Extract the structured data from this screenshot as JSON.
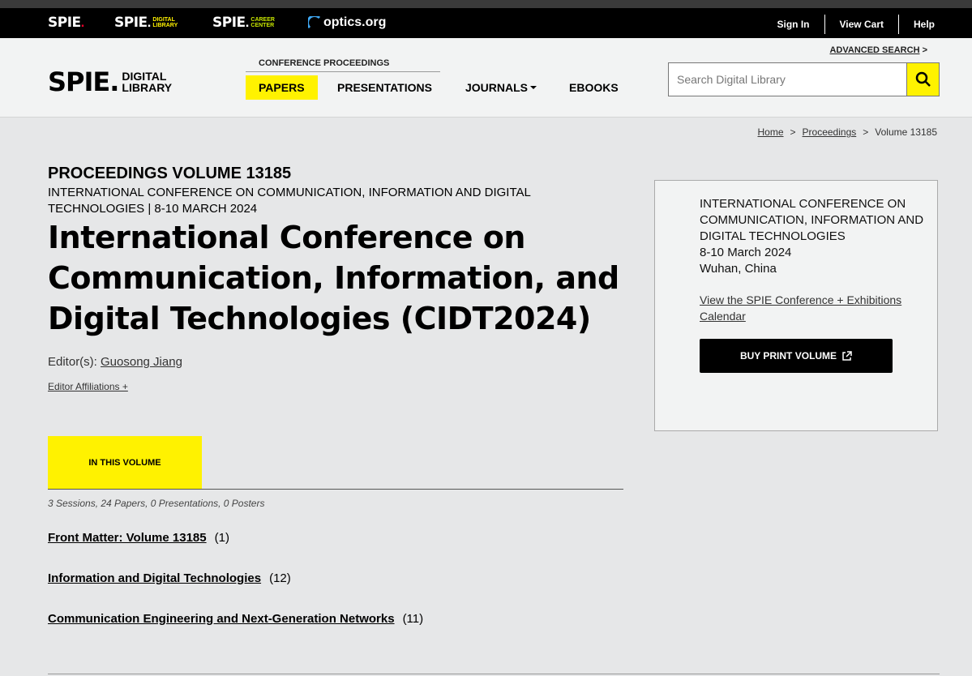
{
  "topbar": {
    "brands": [
      {
        "name": "SPIE",
        "sub": ""
      },
      {
        "name": "SPIE",
        "sub_line1": "DIGITAL",
        "sub_line2": "LIBRARY"
      },
      {
        "name": "SPIE",
        "sub_line1": "CAREER",
        "sub_line2": "CENTER"
      }
    ],
    "optics_label": "optics.org",
    "links": [
      "Sign In",
      "View Cart",
      "Help"
    ]
  },
  "header": {
    "logo_main": "SPIE.",
    "logo_sub1": "DIGITAL",
    "logo_sub2": "LIBRARY",
    "conference_label": "CONFERENCE PROCEEDINGS",
    "nav": [
      "PAPERS",
      "PRESENTATIONS",
      "JOURNALS",
      "EBOOKS"
    ],
    "advanced_search": "ADVANCED SEARCH",
    "search_placeholder": "Search Digital Library"
  },
  "breadcrumb": [
    "Home",
    "Proceedings",
    "Volume 13185"
  ],
  "main": {
    "volume_heading": "PROCEEDINGS VOLUME 13185",
    "volume_subheading": "INTERNATIONAL CONFERENCE ON COMMUNICATION, INFORMATION AND DIGITAL TECHNOLOGIES | 8-10 MARCH 2024",
    "title": "International Conference on Communication, Information, and Digital Technologies (CIDT2024)",
    "editors_label": "Editor(s):",
    "editor_name": "Guosong Jiang",
    "editor_affiliations": "Editor Affiliations +",
    "tab_label": "IN THIS VOLUME",
    "counts": "3 Sessions, 24 Papers, 0 Presentations, 0 Posters",
    "sessions": [
      {
        "title": "Front Matter: Volume 13185",
        "count": "(1)"
      },
      {
        "title": "Information and Digital Technologies",
        "count": "(12)"
      },
      {
        "title": "Communication Engineering and Next-Generation Networks",
        "count": "(11)"
      }
    ]
  },
  "sidebar": {
    "conference_name": "INTERNATIONAL CONFERENCE ON COMMUNICATION, INFORMATION AND DIGITAL TECHNOLOGIES",
    "dates": "8-10 March 2024",
    "location": "Wuhan, China",
    "calendar_link": "View the SPIE Conference + Exhibitions Calendar",
    "buy_button": "BUY PRINT VOLUME"
  },
  "colors": {
    "accent": "#fff200",
    "dark": "#000000",
    "spie_red": "#e4002b"
  }
}
